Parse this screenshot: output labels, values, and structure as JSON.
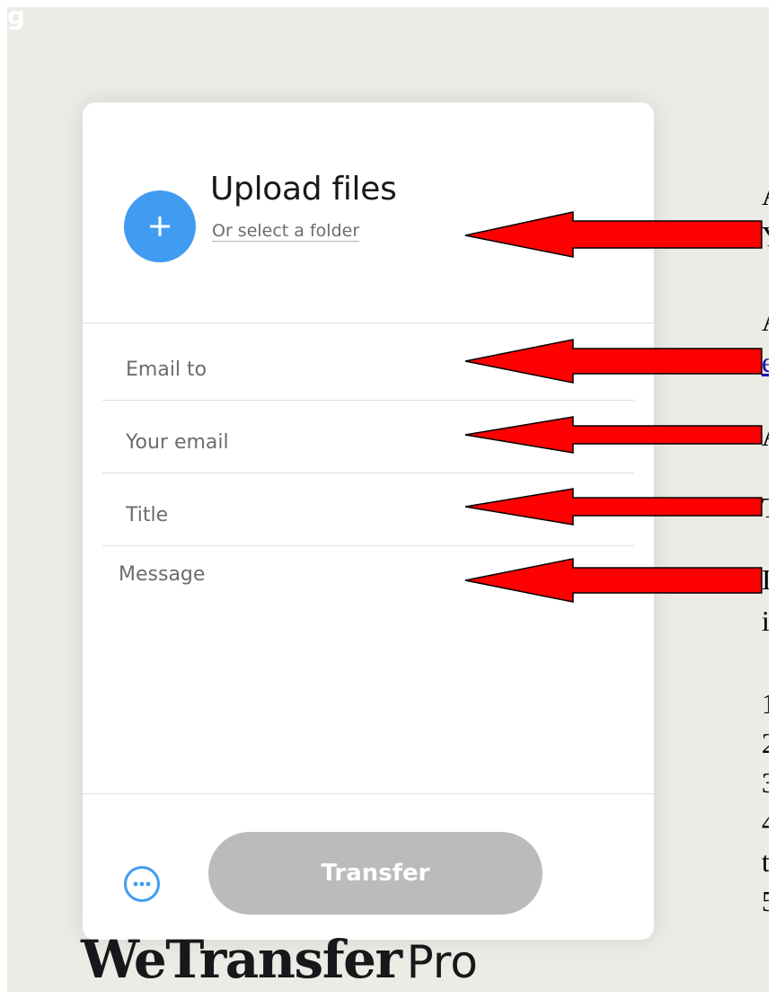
{
  "corner_mark": "g",
  "upload": {
    "title": "Upload files",
    "folder_link": "Or select a folder",
    "plus_icon": "plus-icon"
  },
  "form": {
    "email_to": {
      "placeholder": "Email to"
    },
    "your_email": {
      "placeholder": "Your email"
    },
    "title": {
      "placeholder": "Title"
    },
    "message": {
      "placeholder": "Message"
    }
  },
  "footer": {
    "more_icon": "more-options-icon",
    "transfer_label": "Transfer"
  },
  "brand": {
    "name": "WeTransfer",
    "suffix": "Pro"
  },
  "annotations": [
    {
      "text": "A"
    },
    {
      "text": "Y"
    },
    {
      "text": "A"
    },
    {
      "text": "e"
    },
    {
      "text": "A"
    },
    {
      "text": "T"
    },
    {
      "text": "I"
    },
    {
      "text": "i"
    },
    {
      "text": "1"
    },
    {
      "text": "2"
    },
    {
      "text": "3"
    },
    {
      "text": "4"
    },
    {
      "text": "t"
    },
    {
      "text": "5"
    }
  ],
  "colors": {
    "page_background": "#ecebe5",
    "card": "#ffffff",
    "accent_blue": "#409cf1",
    "transfer_disabled": "#babbbd",
    "annotation_arrow": "#ff0000",
    "annotation_link": "#1a0dab"
  }
}
